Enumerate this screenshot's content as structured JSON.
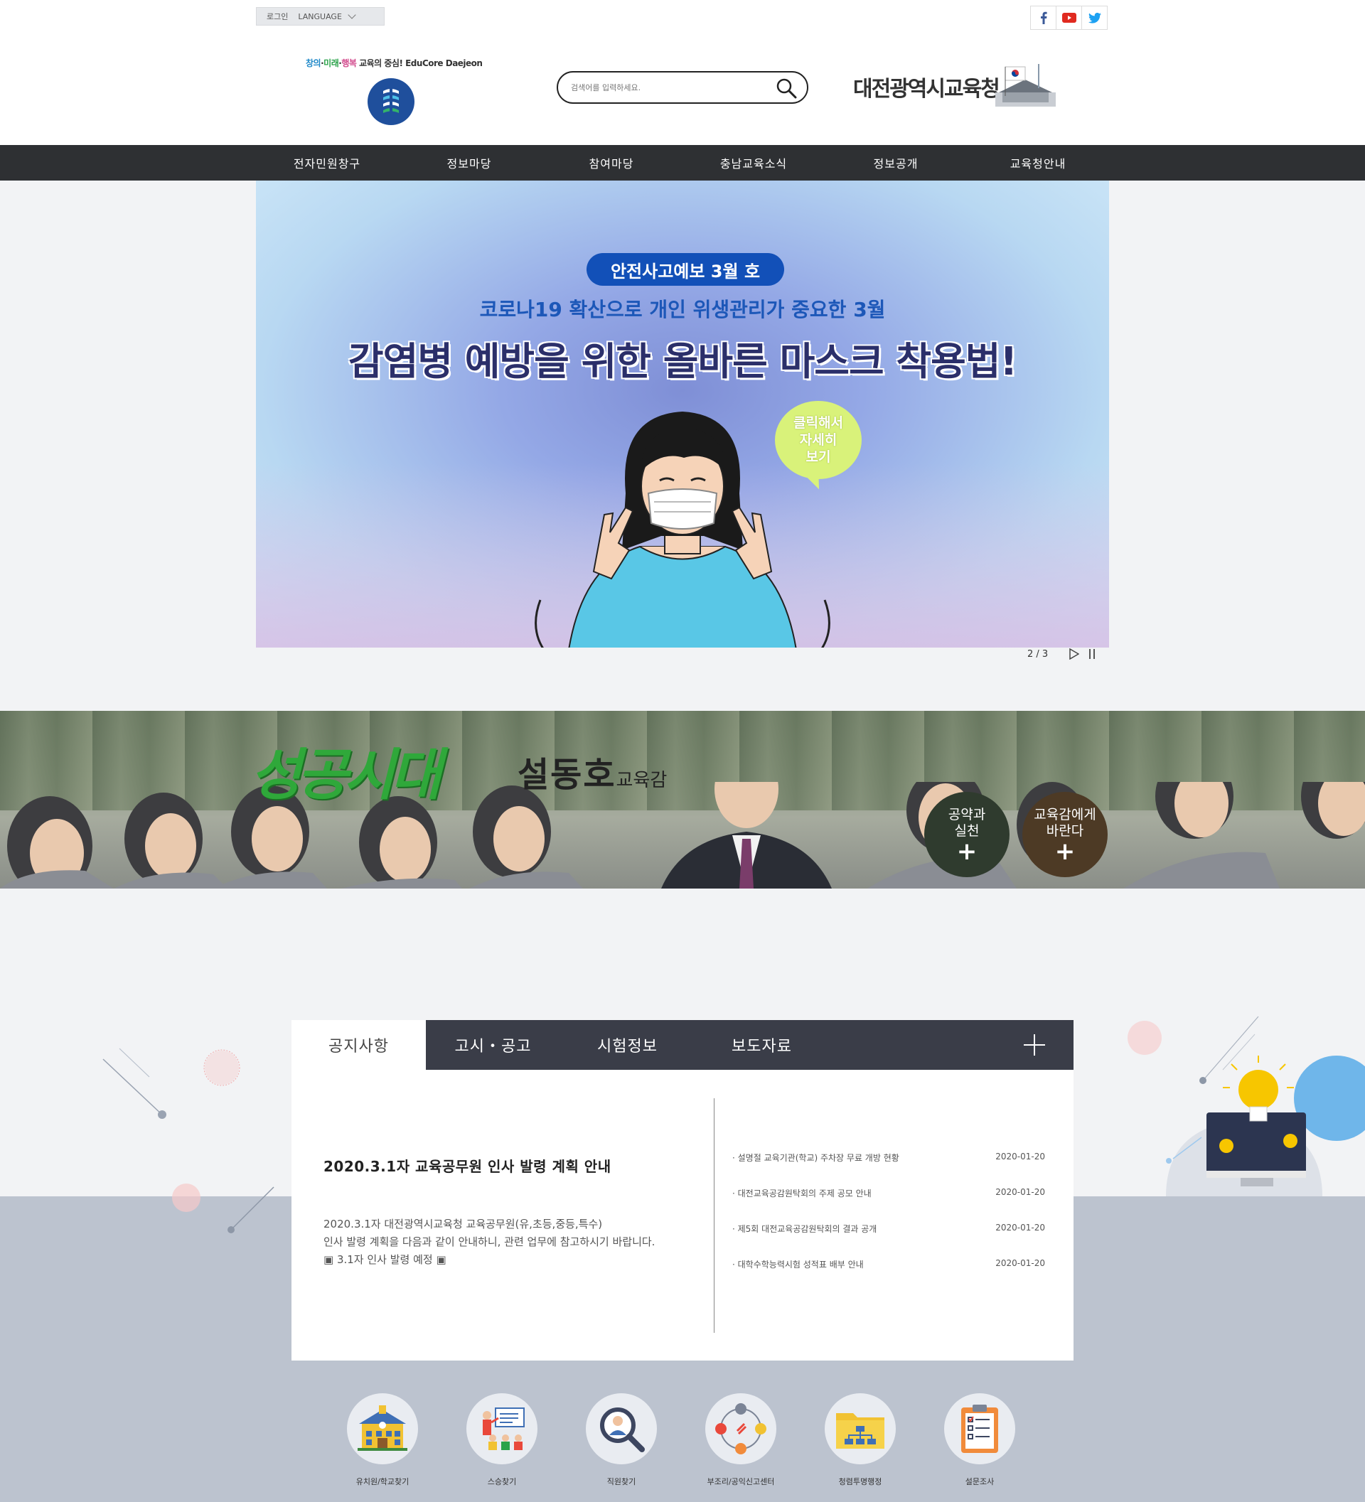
{
  "util": {
    "login": "로그인",
    "language": "LANGUAGE"
  },
  "social": [
    "facebook-icon",
    "youtube-icon",
    "twitter-icon"
  ],
  "logo": {
    "slogan_1": "창의",
    "slogan_dot1": "·",
    "slogan_2": "미래",
    "slogan_dot2": "·",
    "slogan_3": "행복",
    "slogan_rest": " 교육의 중심! EduCore Daejeon"
  },
  "search": {
    "placeholder": "검색어를 입력하세요."
  },
  "org": {
    "name": "대전광역시교육청"
  },
  "gnb": [
    "전자민원창구",
    "정보마당",
    "참여마당",
    "충남교육소식",
    "정보공개",
    "교육청안내"
  ],
  "hero": {
    "pill": "안전사고예보 3월 호",
    "sub": "코로나19 확산으로 개인 위생관리가 중요한 3월",
    "main": "감염병 예방을 위한 올바른 마스크 착용법!",
    "bubble_1": "클릭해서",
    "bubble_2": "자세히",
    "bubble_3": "보기",
    "counter": "2 / 3"
  },
  "banner": {
    "slogan": "성공시대",
    "name": "설동호",
    "title": "교육감",
    "btn1_l1": "공약과",
    "btn1_l2": "실천",
    "btn2_l1": "교육감에게",
    "btn2_l2": "바란다",
    "plus": "+"
  },
  "board": {
    "tabs": [
      "공지사항",
      "고시・공고",
      "시험정보",
      "보도자료"
    ],
    "active_tab": "공지사항",
    "featured_title": "2020.3.1자 교육공무원 인사 발령 계획 안내",
    "featured_desc_1": "2020.3.1자 대전광역시교육청 교육공무원(유,초등,중등,특수)",
    "featured_desc_2": "인사 발령 계획을 다음과 같이 안내하니, 관련 업무에 참고하시기 바랍니다.",
    "featured_desc_3": "▣ 3.1자 인사 발령 예정 ▣",
    "items": [
      {
        "title": "· 설명절 교육기관(학교) 주차장 무료 개방 현황",
        "date": "2020-01-20"
      },
      {
        "title": "· 대전교육공감원탁회의 주제 공모 안내",
        "date": "2020-01-20"
      },
      {
        "title": "· 제5회 대전교육공감원탁회의 결과 공개",
        "date": "2020-01-20"
      },
      {
        "title": "· 대학수학능력시험 성적표 배부 안내",
        "date": "2020-01-20"
      }
    ]
  },
  "quick": [
    {
      "label": "유치원/학교찾기",
      "icon": "school-icon"
    },
    {
      "label": "스승찾기",
      "icon": "teacher-icon"
    },
    {
      "label": "직원찾기",
      "icon": "staff-search-icon"
    },
    {
      "label": "부조리/공익신고센터",
      "icon": "report-center-icon"
    },
    {
      "label": "청렴투명행정",
      "icon": "transparency-folder-icon"
    },
    {
      "label": "설문조사",
      "icon": "survey-clipboard-icon"
    }
  ],
  "colors": {
    "gnb_bg": "#2e3033",
    "board_tab_bg": "#3a3d48",
    "hero_pill": "#1250b8",
    "slogan_green": "#2fa83a"
  }
}
